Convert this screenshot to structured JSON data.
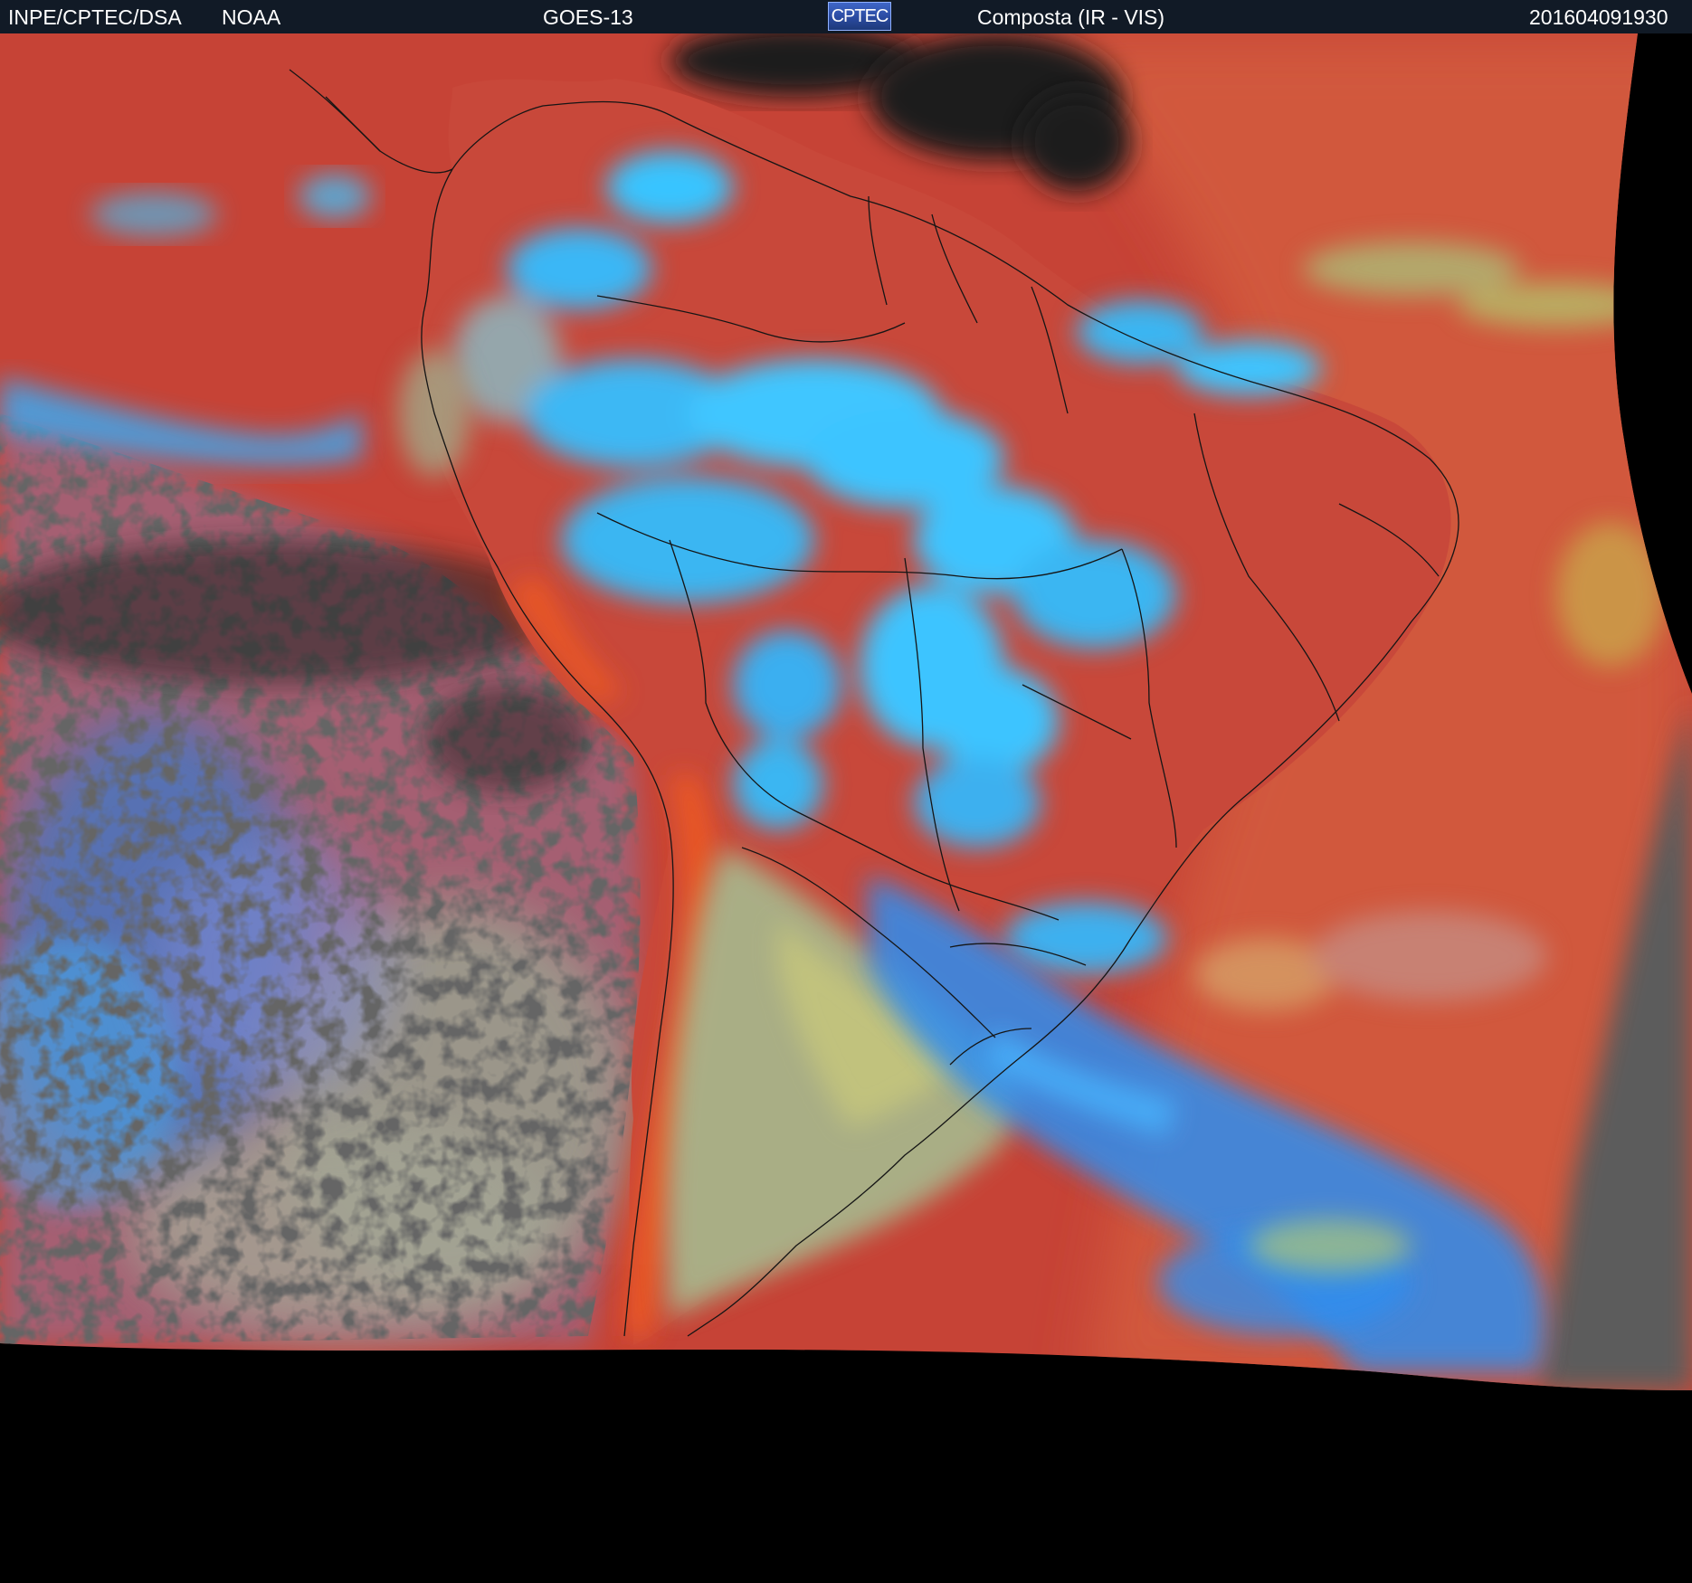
{
  "header": {
    "agency": "INPE/CPTEC/DSA",
    "source": "NOAA",
    "satellite": "GOES-13",
    "logo_text": "CPTEC",
    "product": "Composta (IR - VIS)",
    "timestamp": "201604091930"
  },
  "colors": {
    "header_bg": "#111a26",
    "ocean_warm": "#c9473a",
    "cloud_high": "#2fb6ff",
    "cloud_mid": "#8fb09a",
    "clear_dark": "#222222",
    "outside_disk": "#000000",
    "border_lines": "#1a1a1a"
  }
}
